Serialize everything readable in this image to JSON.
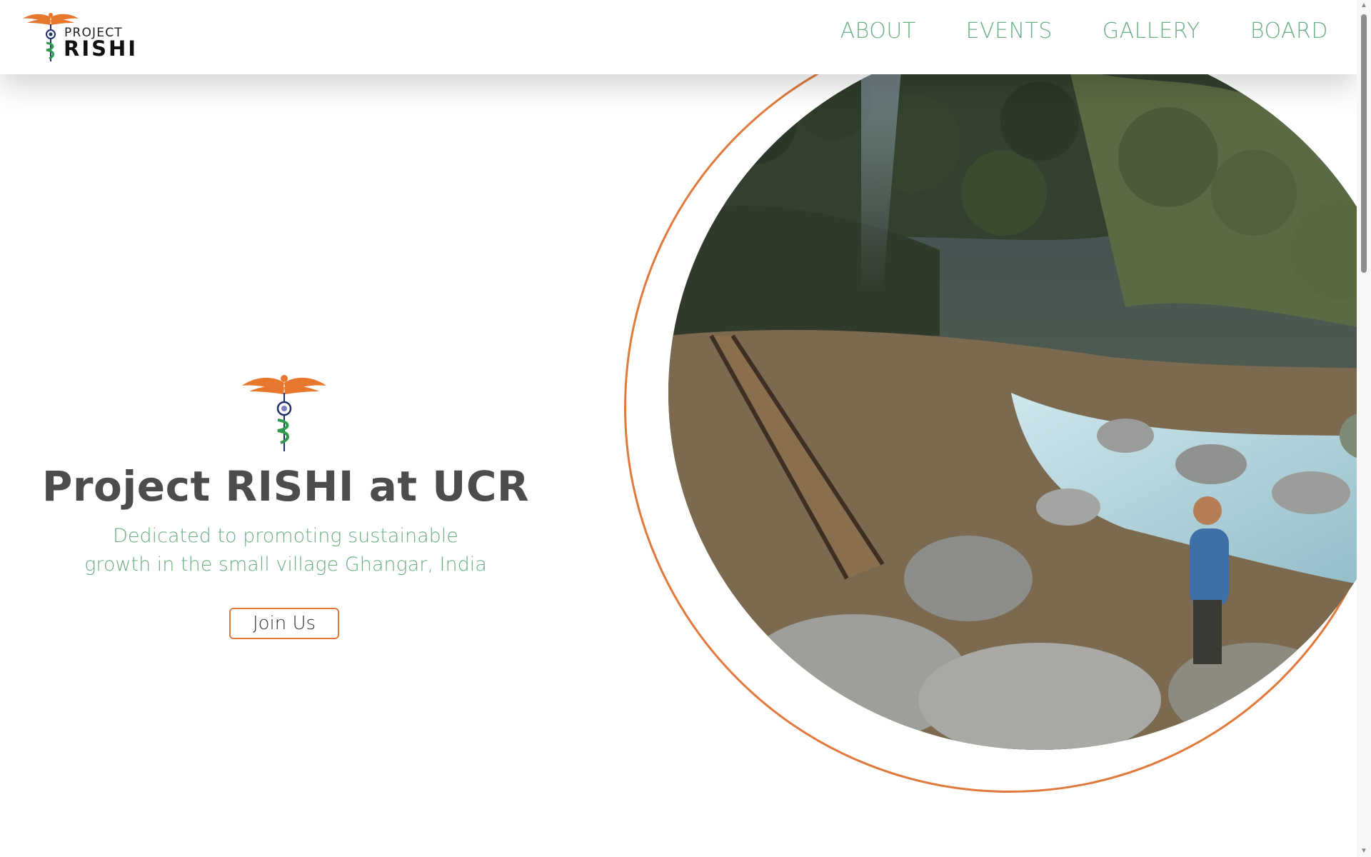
{
  "brand": {
    "logo_word_top": "PROJECT",
    "logo_word_bottom": "RISHI",
    "accent_orange": "#e07a3c",
    "accent_green": "#6aaf83",
    "text_dark": "#4c4c4c"
  },
  "nav": {
    "items": [
      {
        "label": "ABOUT"
      },
      {
        "label": "EVENTS"
      },
      {
        "label": "GALLERY"
      },
      {
        "label": "BOARD"
      }
    ]
  },
  "hero": {
    "title": "Project RISHI at UCR",
    "subtitle_line1": "Dedicated to promoting sustainable",
    "subtitle_line2": "growth in the small village Ghangar, India",
    "cta_label": "Join Us",
    "emblem_icon": "caduceus-icon",
    "photo": "mountain-river-bridge-photo"
  }
}
